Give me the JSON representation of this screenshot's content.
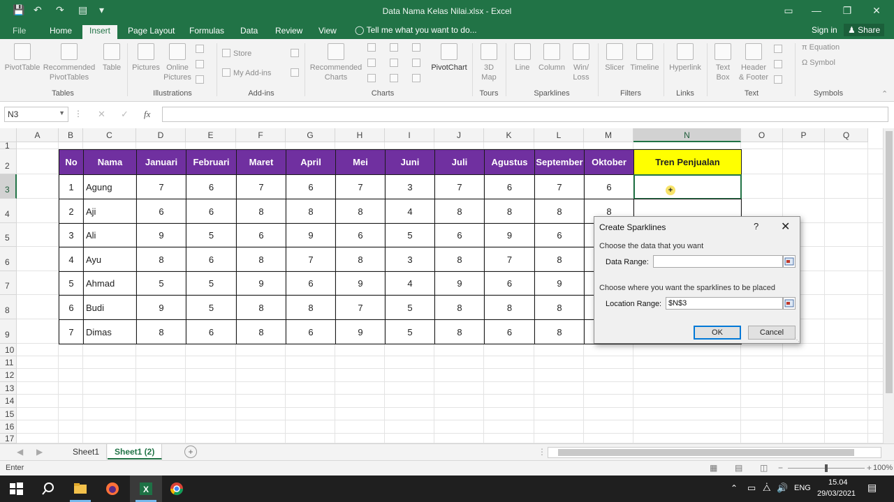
{
  "titlebar": {
    "title": "Data Nama Kelas Nilai.xlsx - Excel"
  },
  "tabs": [
    {
      "label": "File"
    },
    {
      "label": "Home"
    },
    {
      "label": "Insert",
      "active": true
    },
    {
      "label": "Page Layout"
    },
    {
      "label": "Formulas"
    },
    {
      "label": "Data"
    },
    {
      "label": "Review"
    },
    {
      "label": "View"
    }
  ],
  "tellme": "Tell me what you want to do...",
  "signin": "Sign in",
  "share": "Share",
  "ribbon": {
    "tables": {
      "pivottable": "PivotTable",
      "recommended_pivot_1": "Recommended",
      "recommended_pivot_2": "PivotTables",
      "table": "Table",
      "group": "Tables"
    },
    "illustrations": {
      "pictures": "Pictures",
      "online_1": "Online",
      "online_2": "Pictures",
      "group": "Illustrations"
    },
    "addins": {
      "store": "Store",
      "myaddins": "My Add-ins",
      "group": "Add-ins"
    },
    "charts": {
      "recommended_1": "Recommended",
      "recommended_2": "Charts",
      "pivotchart": "PivotChart",
      "group": "Charts"
    },
    "tours": {
      "map_1": "3D",
      "map_2": "Map",
      "group": "Tours"
    },
    "sparklines": {
      "line": "Line",
      "column": "Column",
      "winloss_1": "Win/",
      "winloss_2": "Loss",
      "group": "Sparklines"
    },
    "filters": {
      "slicer": "Slicer",
      "timeline": "Timeline",
      "group": "Filters"
    },
    "links": {
      "hyperlink": "Hyperlink",
      "group": "Links"
    },
    "text": {
      "textbox_1": "Text",
      "textbox_2": "Box",
      "header_1": "Header",
      "header_2": "& Footer",
      "group": "Text"
    },
    "symbols": {
      "equation": "Equation",
      "symbol": "Symbol",
      "group": "Symbols"
    }
  },
  "namebox": "N3",
  "fx": "fx",
  "columns": [
    "A",
    "B",
    "C",
    "D",
    "E",
    "F",
    "G",
    "H",
    "I",
    "J",
    "K",
    "L",
    "M",
    "N",
    "O",
    "P",
    "Q"
  ],
  "rows": [
    "1",
    "2",
    "3",
    "4",
    "5",
    "6",
    "7",
    "8",
    "9",
    "10",
    "11",
    "12",
    "13",
    "14",
    "15",
    "16",
    "17"
  ],
  "table": {
    "headers": [
      "No",
      "Nama",
      "Januari",
      "Februari",
      "Maret",
      "April",
      "Mei",
      "Juni",
      "Juli",
      "Agustus",
      "September",
      "Oktober",
      "Tren Penjualan"
    ],
    "rows": [
      [
        "1",
        "Agung",
        "7",
        "6",
        "7",
        "6",
        "7",
        "3",
        "7",
        "6",
        "7",
        "6",
        ""
      ],
      [
        "2",
        "Aji",
        "6",
        "6",
        "8",
        "8",
        "8",
        "4",
        "8",
        "8",
        "8",
        "8",
        ""
      ],
      [
        "3",
        "Ali",
        "9",
        "5",
        "6",
        "9",
        "6",
        "5",
        "6",
        "9",
        "6",
        "",
        ""
      ],
      [
        "4",
        "Ayu",
        "8",
        "6",
        "8",
        "7",
        "8",
        "3",
        "8",
        "7",
        "8",
        "",
        ""
      ],
      [
        "5",
        "Ahmad",
        "5",
        "5",
        "9",
        "6",
        "9",
        "4",
        "9",
        "6",
        "9",
        "",
        ""
      ],
      [
        "6",
        "Budi",
        "9",
        "5",
        "8",
        "8",
        "7",
        "5",
        "8",
        "8",
        "8",
        "",
        ""
      ],
      [
        "7",
        "Dimas",
        "8",
        "6",
        "8",
        "6",
        "9",
        "5",
        "8",
        "6",
        "8",
        "",
        ""
      ]
    ]
  },
  "sheets": [
    {
      "label": "Sheet1"
    },
    {
      "label": "Sheet1 (2)",
      "active": true
    }
  ],
  "status": {
    "mode": "Enter",
    "zoom": "100%"
  },
  "taskbar": {
    "lang": "ENG",
    "time": "15.04",
    "date": "29/03/2021"
  },
  "dialog": {
    "title": "Create Sparklines",
    "help": "?",
    "close": "✕",
    "section1": "Choose the data that you want",
    "data_range_label": "Data Range:",
    "data_range_value": "",
    "section2": "Choose where you want the sparklines to be placed",
    "location_label": "Location Range:",
    "location_value": "$N$3",
    "ok": "OK",
    "cancel": "Cancel"
  }
}
